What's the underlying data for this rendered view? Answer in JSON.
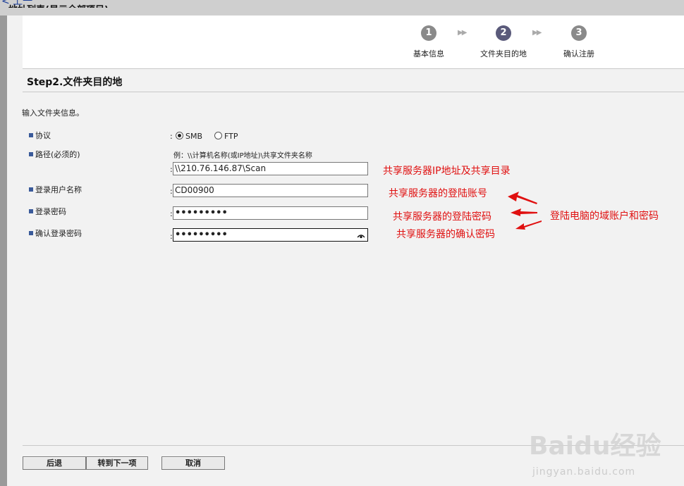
{
  "background": {
    "back_link": "< 上一",
    "list_title": "地址列表(显示全部项目)"
  },
  "steps": [
    {
      "num": "1",
      "label": "基本信息"
    },
    {
      "num": "2",
      "label": "文件夹目的地"
    },
    {
      "num": "3",
      "label": "确认注册"
    }
  ],
  "step_title": "Step2.文件夹目的地",
  "intro": "输入文件夹信息。",
  "fields": {
    "protocol": {
      "label": "协议",
      "options": [
        "SMB",
        "FTP"
      ],
      "selected": "SMB"
    },
    "path": {
      "label": "路径(必须的)",
      "example": "例：\\\\计算机名称(或IP地址)\\共享文件夹名称",
      "value": "\\\\210.76.146.87\\Scan"
    },
    "username": {
      "label": "登录用户名称",
      "value": "CD00900"
    },
    "password": {
      "label": "登录密码",
      "value": "•••••••••"
    },
    "confirm": {
      "label": "确认登录密码",
      "value": "•••••••••"
    }
  },
  "annotations": {
    "path": "共享服务器IP地址及共享目录",
    "username": "共享服务器的登陆账号",
    "password": "共享服务器的登陆密码",
    "confirm": "共享服务器的确认密码",
    "domain": "登陆电脑的域账户和密码"
  },
  "buttons": {
    "back": "后退",
    "next": "转到下一项",
    "cancel": "取消"
  },
  "watermark": {
    "logo": "Baidu经验",
    "url": "jingyan.baidu.com"
  },
  "colors": {
    "annotation": "#e01010",
    "step_active": "#5a5a7a",
    "step_inactive": "#8a8a8a"
  }
}
